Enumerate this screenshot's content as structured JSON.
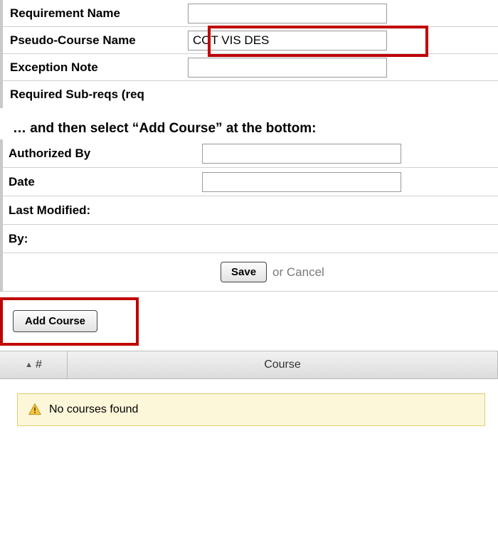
{
  "form1": {
    "requirement_name_label": "Requirement Name",
    "requirement_name_value": "",
    "pseudo_course_label": "Pseudo-Course Name",
    "pseudo_course_value": "COT VIS DES",
    "exception_note_label": "Exception Note",
    "exception_note_value": "",
    "required_subreqs_label": "Required Sub-reqs (req"
  },
  "instruction": "… and then select “Add Course” at the bottom:",
  "form2": {
    "authorized_by_label": "Authorized By",
    "authorized_by_value": "",
    "date_label": "Date",
    "date_value": "",
    "last_modified_label": "Last Modified:",
    "by_label": "By:"
  },
  "actions": {
    "save_label": "Save",
    "or_cancel": "or Cancel",
    "add_course_label": "Add Course"
  },
  "table": {
    "col_num": "#",
    "col_course": "Course",
    "empty_msg": "No courses found"
  }
}
